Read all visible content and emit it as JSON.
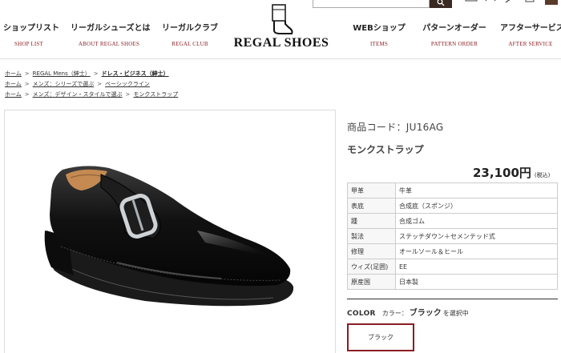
{
  "nav": {
    "items": [
      {
        "main": "ショップリスト",
        "sub": "SHOP LIST"
      },
      {
        "main": "リーガルシューズとは",
        "sub": "ABOUT REGAL SHOES"
      },
      {
        "main": "リーガルクラブ",
        "sub": "REGAL CLUB"
      },
      {
        "main": "WEBショップ",
        "sub": "ITEMS"
      },
      {
        "main": "パターンオーダー",
        "sub": "PATTERN ORDER"
      },
      {
        "main": "アフターサービス",
        "sub": "AFTER SERVICE"
      }
    ],
    "logo_text": "REGAL SHOES"
  },
  "breadcrumbs": [
    [
      "ホーム",
      "REGAL Mens（紳士）",
      "ドレス・ビジネス（紳士）"
    ],
    [
      "ホーム",
      "メンズ：シリーズで選ぶ",
      "ベーシックライン"
    ],
    [
      "ホーム",
      "メンズ：デザイン・スタイルで選ぶ",
      "モンクストラップ"
    ]
  ],
  "product": {
    "code": "商品コード：JU16AG",
    "name": "モンクストラップ",
    "price": "23,100円",
    "price_tax": "(税込)",
    "specs": [
      {
        "k": "甲革",
        "v": "牛革"
      },
      {
        "k": "表底",
        "v": "合成底（スポンジ）"
      },
      {
        "k": "踵",
        "v": "合成ゴム"
      },
      {
        "k": "製法",
        "v": "ステッチダウン＋セメンテッド式"
      },
      {
        "k": "修理",
        "v": "オールソール＆ヒール"
      },
      {
        "k": "ウィズ(足囲)",
        "v": "EE"
      },
      {
        "k": "原産国",
        "v": "日本製"
      }
    ]
  },
  "color": {
    "heading": "COLOR",
    "label": "カラー：",
    "value": "ブラック",
    "suffix": "を選択中",
    "swatch": "ブラック",
    "accent": "#8a1e24"
  }
}
